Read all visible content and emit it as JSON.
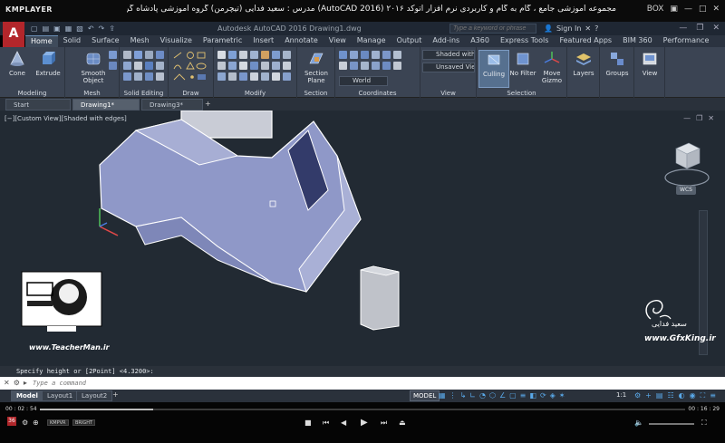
{
  "player": {
    "logo": "KMPLAYER",
    "caption": "مجموعه آموزشی جامع ، گام به گام و کاربردی نرم افزار اتوکد ۲۰۱۶ (AutoCAD 2016) مدرس : سعید فدایی (تیچرمن) گروه آموزشی پادشاه گرافیست ها",
    "box_label": "BOX",
    "time_current": "00 : 02 : 54",
    "time_total": "00 : 16 : 29",
    "progress": 0.176,
    "playlist_num": "36",
    "chip1": "KMPVR",
    "chip2": "BRIGHT"
  },
  "app": {
    "logo_letter": "A",
    "doc_title": "Autodesk AutoCAD 2016   Drawing1.dwg",
    "search_placeholder": "Type a keyword or phrase",
    "sign_in": "Sign In"
  },
  "ribbon_tabs": [
    "Home",
    "Solid",
    "Surface",
    "Mesh",
    "Visualize",
    "Parametric",
    "Insert",
    "Annotate",
    "View",
    "Manage",
    "Output",
    "Add-ins",
    "A360",
    "Express Tools",
    "Featured Apps",
    "BIM 360",
    "Performance"
  ],
  "ribbon": {
    "cone": "Cone",
    "extrude": "Extrude",
    "smooth": "Smooth Object",
    "section_plane": "Section Plane",
    "visual_style": "Shaded with e...",
    "view_saved": "Unsaved View",
    "ucs_world": "World",
    "culling": "Culling",
    "no_filter": "No Filter",
    "move_gizmo": "Move Gizmo",
    "layers": "Layers",
    "groups": "Groups",
    "view_btn": "View",
    "panels": {
      "modeling": "Modeling",
      "mesh": "Mesh",
      "solid_editing": "Solid Editing",
      "draw": "Draw",
      "modify": "Modify",
      "section": "Section",
      "coordinates": "Coordinates",
      "view": "View",
      "selection": "Selection"
    }
  },
  "file_tabs": [
    "Start",
    "Drawing1*",
    "Drawing3*"
  ],
  "viewport": {
    "label": "[−][Custom View][Shaded with edges]",
    "wcs": "WCS"
  },
  "watermarks": {
    "teacher_url": "www.TeacherMan.ir",
    "gfx_name": "سعید فدایی",
    "gfx_url": "www.GfxKing.ir"
  },
  "command": {
    "history": "Specify height or [2Point] <4.3200>:",
    "placeholder": "Type a command"
  },
  "layouts": [
    "Model",
    "Layout1",
    "Layout2"
  ],
  "status": {
    "model": "MODEL",
    "scale": "1:1"
  },
  "colors": {
    "acad_red": "#b3262b",
    "viewport_bg": "#222a33",
    "solid_fill": "#8f98c8",
    "status_blue": "#59a8e8"
  }
}
